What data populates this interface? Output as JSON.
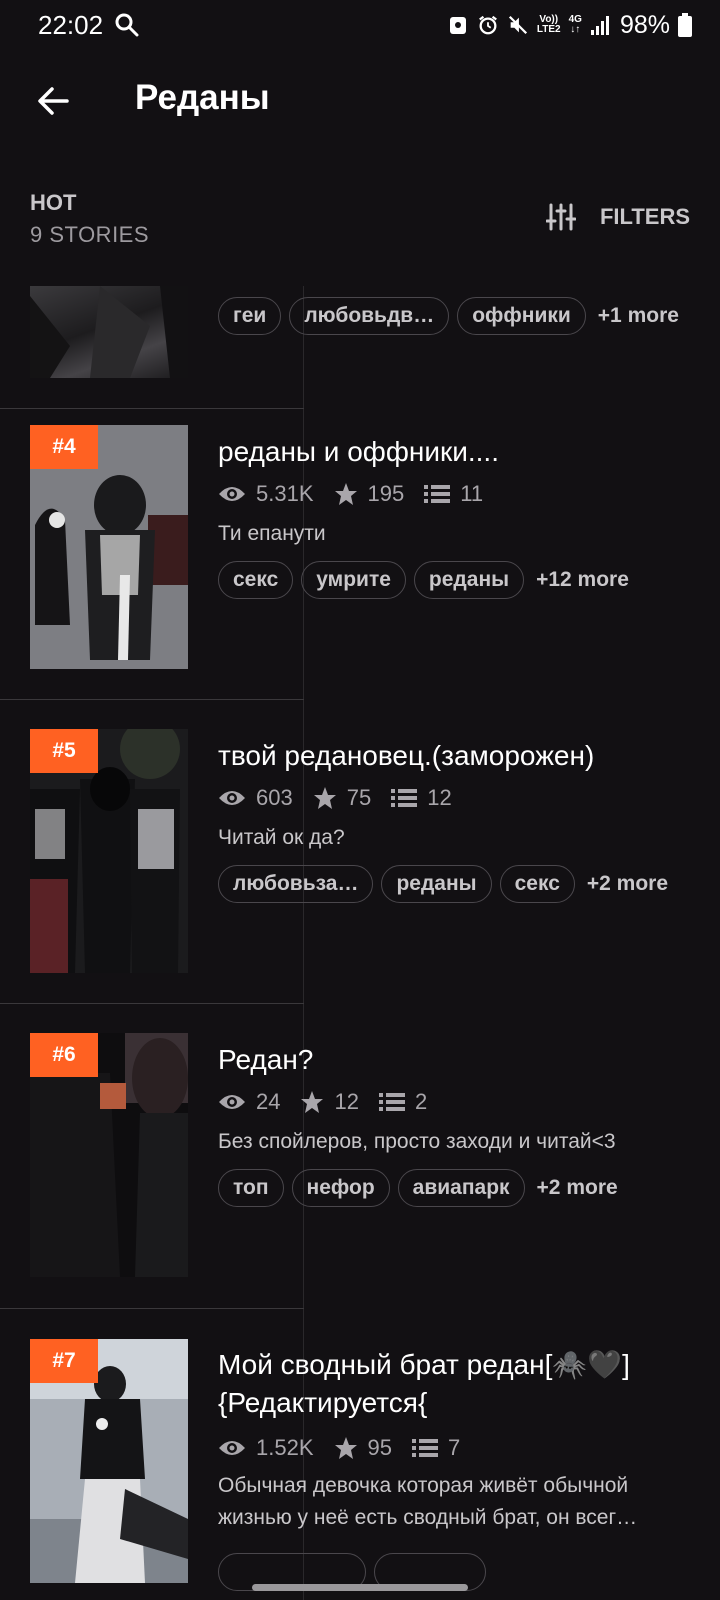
{
  "status_bar": {
    "time": "22:02",
    "lte_label_1": "Vo))",
    "lte_label_2": "LTE2",
    "net_label": "4G",
    "battery": "98%"
  },
  "header": {
    "title": "Реданы"
  },
  "sort": {
    "label": "HOT",
    "count": "9 STORIES",
    "filters_label": "FILTERS"
  },
  "stories": [
    {
      "rank": "",
      "title": "",
      "views": "",
      "votes": "",
      "parts": "",
      "description": "",
      "tags": [
        "геи",
        "любовьдв…",
        "оффники"
      ],
      "more": "+1 more"
    },
    {
      "rank": "#4",
      "title": "реданы и оффники....",
      "views": "5.31K",
      "votes": "195",
      "parts": "11",
      "description": "Ти епанути",
      "tags": [
        "секс",
        "умрите",
        "реданы"
      ],
      "more": "+12 more"
    },
    {
      "rank": "#5",
      "title": "твой редановец.(заморожен)",
      "views": "603",
      "votes": "75",
      "parts": "12",
      "description": "Читай ок да?",
      "tags": [
        "любовьза…",
        "реданы",
        "секс"
      ],
      "more": "+2 more"
    },
    {
      "rank": "#6",
      "title": "Редан?",
      "views": "24",
      "votes": "12",
      "parts": "2",
      "description": "Без спойлеров, просто заходи и читай<3",
      "tags": [
        "топ",
        "нефор",
        "авиапарк"
      ],
      "more": "+2 more"
    },
    {
      "rank": "#7",
      "title": "Мой сводный брат редан[🕷️🖤] {Редактируется{",
      "views": "1.52K",
      "votes": "95",
      "parts": "7",
      "description": "Обычная девочка которая живёт обычной жизнью у неё есть сводный брат, он всег…",
      "tags": [],
      "more": ""
    }
  ],
  "colors": {
    "background": "#121013",
    "accent": "#ff6122",
    "muted_text": "#a9a6ab"
  }
}
